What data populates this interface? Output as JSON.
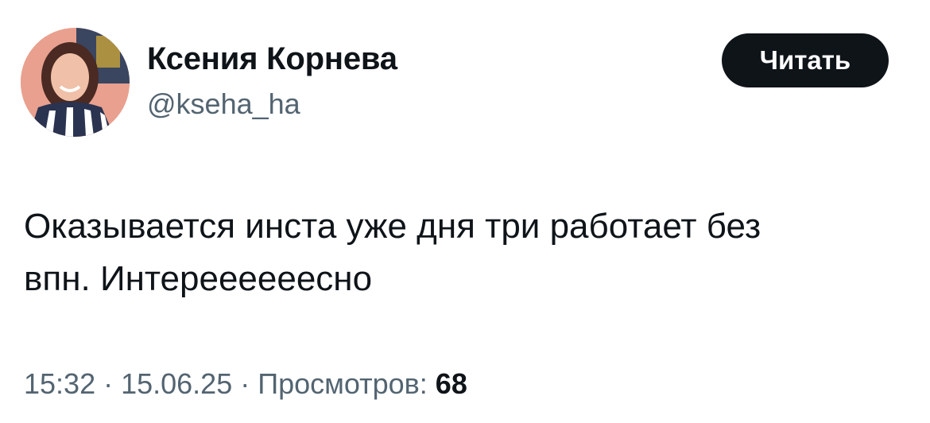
{
  "author": {
    "name": "Ксения Корнева",
    "handle": "@kseha_ha"
  },
  "follow_button": {
    "label": "Читать"
  },
  "tweet": {
    "text": "Оказывается инста уже дня три работает без\nвпн. Интереееееесно"
  },
  "meta": {
    "time": "15:32",
    "separator1": " · ",
    "date": "15.06.25",
    "separator2": " · ",
    "views_label": "Просмотров: ",
    "views_count": "68"
  },
  "colors": {
    "text_primary": "#0f1419",
    "text_secondary": "#536471",
    "button_bg": "#0f1419",
    "button_text": "#ffffff",
    "background": "#ffffff"
  }
}
